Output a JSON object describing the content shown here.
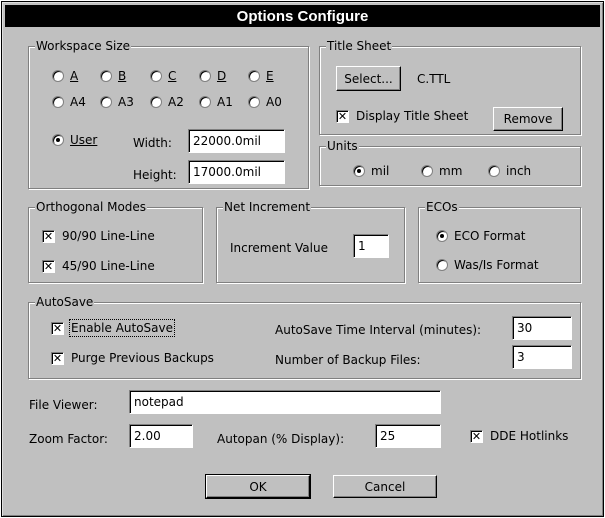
{
  "window": {
    "title": "Options Configure"
  },
  "workspace": {
    "label": "Workspace Size",
    "sizes_row1": [
      "A",
      "B",
      "C",
      "D",
      "E"
    ],
    "sizes_row2": [
      "A4",
      "A3",
      "A2",
      "A1",
      "A0"
    ],
    "user_label": "User",
    "selected": "User",
    "width_label": "Width:",
    "width_value": "22000.0mil",
    "height_label": "Height:",
    "height_value": "17000.0mil"
  },
  "title_sheet": {
    "label": "Title Sheet",
    "select_button": "Select...",
    "filename": "C.TTL",
    "display_label": "Display Title Sheet",
    "display_checked": true,
    "remove_button": "Remove"
  },
  "units": {
    "label": "Units",
    "options": [
      "mil",
      "mm",
      "inch"
    ],
    "selected": "mil"
  },
  "orthogonal": {
    "label": "Orthogonal Modes",
    "items": [
      {
        "label": "90/90  Line-Line",
        "checked": true
      },
      {
        "label": "45/90  Line-Line",
        "checked": true
      }
    ]
  },
  "net_increment": {
    "label": "Net Increment",
    "value_label": "Increment Value",
    "value": "1"
  },
  "ecos": {
    "label": "ECOs",
    "options": [
      "ECO Format",
      "Was/Is Format"
    ],
    "selected": "ECO Format"
  },
  "autosave": {
    "label": "AutoSave",
    "enable_label": "Enable AutoSave",
    "enable_checked": true,
    "purge_label": "Purge Previous Backups",
    "purge_checked": true,
    "interval_label": "AutoSave Time Interval (minutes):",
    "interval_value": "30",
    "backups_label": "Number of Backup Files:",
    "backups_value": "3"
  },
  "file_viewer": {
    "label": "File Viewer:",
    "value": "notepad"
  },
  "zoom": {
    "label": "Zoom Factor:",
    "value": "2.00"
  },
  "autopan": {
    "label": "Autopan (% Display):",
    "value": "25"
  },
  "dde": {
    "label": "DDE Hotlinks",
    "checked": true
  },
  "buttons": {
    "ok": "OK",
    "cancel": "Cancel"
  },
  "check_mark": "✕"
}
